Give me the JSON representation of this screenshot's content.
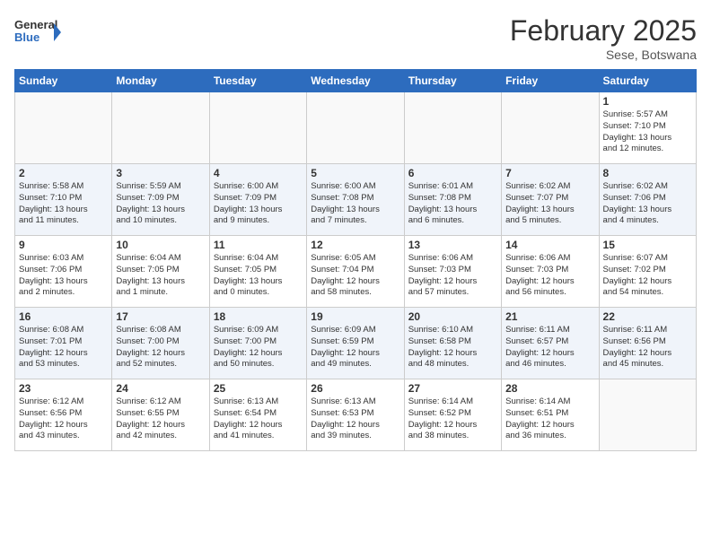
{
  "header": {
    "logo_general": "General",
    "logo_blue": "Blue",
    "title": "February 2025",
    "subtitle": "Sese, Botswana"
  },
  "weekdays": [
    "Sunday",
    "Monday",
    "Tuesday",
    "Wednesday",
    "Thursday",
    "Friday",
    "Saturday"
  ],
  "weeks": [
    [
      {
        "day": "",
        "info": ""
      },
      {
        "day": "",
        "info": ""
      },
      {
        "day": "",
        "info": ""
      },
      {
        "day": "",
        "info": ""
      },
      {
        "day": "",
        "info": ""
      },
      {
        "day": "",
        "info": ""
      },
      {
        "day": "1",
        "info": "Sunrise: 5:57 AM\nSunset: 7:10 PM\nDaylight: 13 hours\nand 12 minutes."
      }
    ],
    [
      {
        "day": "2",
        "info": "Sunrise: 5:58 AM\nSunset: 7:10 PM\nDaylight: 13 hours\nand 11 minutes."
      },
      {
        "day": "3",
        "info": "Sunrise: 5:59 AM\nSunset: 7:09 PM\nDaylight: 13 hours\nand 10 minutes."
      },
      {
        "day": "4",
        "info": "Sunrise: 6:00 AM\nSunset: 7:09 PM\nDaylight: 13 hours\nand 9 minutes."
      },
      {
        "day": "5",
        "info": "Sunrise: 6:00 AM\nSunset: 7:08 PM\nDaylight: 13 hours\nand 7 minutes."
      },
      {
        "day": "6",
        "info": "Sunrise: 6:01 AM\nSunset: 7:08 PM\nDaylight: 13 hours\nand 6 minutes."
      },
      {
        "day": "7",
        "info": "Sunrise: 6:02 AM\nSunset: 7:07 PM\nDaylight: 13 hours\nand 5 minutes."
      },
      {
        "day": "8",
        "info": "Sunrise: 6:02 AM\nSunset: 7:06 PM\nDaylight: 13 hours\nand 4 minutes."
      }
    ],
    [
      {
        "day": "9",
        "info": "Sunrise: 6:03 AM\nSunset: 7:06 PM\nDaylight: 13 hours\nand 2 minutes."
      },
      {
        "day": "10",
        "info": "Sunrise: 6:04 AM\nSunset: 7:05 PM\nDaylight: 13 hours\nand 1 minute."
      },
      {
        "day": "11",
        "info": "Sunrise: 6:04 AM\nSunset: 7:05 PM\nDaylight: 13 hours\nand 0 minutes."
      },
      {
        "day": "12",
        "info": "Sunrise: 6:05 AM\nSunset: 7:04 PM\nDaylight: 12 hours\nand 58 minutes."
      },
      {
        "day": "13",
        "info": "Sunrise: 6:06 AM\nSunset: 7:03 PM\nDaylight: 12 hours\nand 57 minutes."
      },
      {
        "day": "14",
        "info": "Sunrise: 6:06 AM\nSunset: 7:03 PM\nDaylight: 12 hours\nand 56 minutes."
      },
      {
        "day": "15",
        "info": "Sunrise: 6:07 AM\nSunset: 7:02 PM\nDaylight: 12 hours\nand 54 minutes."
      }
    ],
    [
      {
        "day": "16",
        "info": "Sunrise: 6:08 AM\nSunset: 7:01 PM\nDaylight: 12 hours\nand 53 minutes."
      },
      {
        "day": "17",
        "info": "Sunrise: 6:08 AM\nSunset: 7:00 PM\nDaylight: 12 hours\nand 52 minutes."
      },
      {
        "day": "18",
        "info": "Sunrise: 6:09 AM\nSunset: 7:00 PM\nDaylight: 12 hours\nand 50 minutes."
      },
      {
        "day": "19",
        "info": "Sunrise: 6:09 AM\nSunset: 6:59 PM\nDaylight: 12 hours\nand 49 minutes."
      },
      {
        "day": "20",
        "info": "Sunrise: 6:10 AM\nSunset: 6:58 PM\nDaylight: 12 hours\nand 48 minutes."
      },
      {
        "day": "21",
        "info": "Sunrise: 6:11 AM\nSunset: 6:57 PM\nDaylight: 12 hours\nand 46 minutes."
      },
      {
        "day": "22",
        "info": "Sunrise: 6:11 AM\nSunset: 6:56 PM\nDaylight: 12 hours\nand 45 minutes."
      }
    ],
    [
      {
        "day": "23",
        "info": "Sunrise: 6:12 AM\nSunset: 6:56 PM\nDaylight: 12 hours\nand 43 minutes."
      },
      {
        "day": "24",
        "info": "Sunrise: 6:12 AM\nSunset: 6:55 PM\nDaylight: 12 hours\nand 42 minutes."
      },
      {
        "day": "25",
        "info": "Sunrise: 6:13 AM\nSunset: 6:54 PM\nDaylight: 12 hours\nand 41 minutes."
      },
      {
        "day": "26",
        "info": "Sunrise: 6:13 AM\nSunset: 6:53 PM\nDaylight: 12 hours\nand 39 minutes."
      },
      {
        "day": "27",
        "info": "Sunrise: 6:14 AM\nSunset: 6:52 PM\nDaylight: 12 hours\nand 38 minutes."
      },
      {
        "day": "28",
        "info": "Sunrise: 6:14 AM\nSunset: 6:51 PM\nDaylight: 12 hours\nand 36 minutes."
      },
      {
        "day": "",
        "info": ""
      }
    ]
  ]
}
